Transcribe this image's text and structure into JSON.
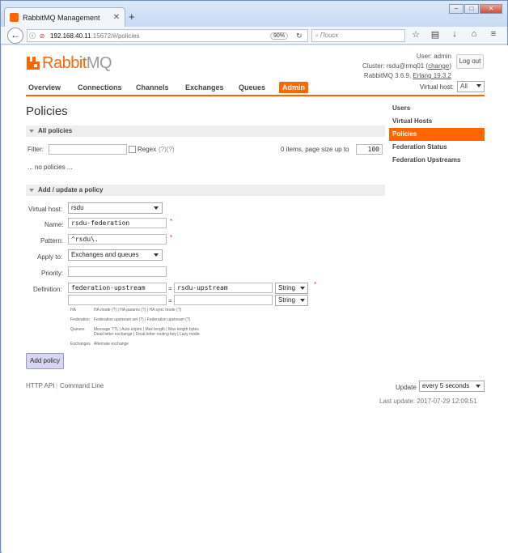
{
  "browser": {
    "tab_title": "RabbitMQ Management",
    "url_host": "192.168.40.11",
    "url_path": ":15672/#/policies",
    "zoom": "90%",
    "search_placeholder": "Поиск"
  },
  "header": {
    "logo_rabbit": "Rabbit",
    "logo_mq": "MQ",
    "user_line": "User: admin",
    "cluster_prefix": "Cluster: rsdu@rmq01 (",
    "cluster_change": "change",
    "cluster_suffix": ")",
    "version_prefix": "RabbitMQ 3.6.9, ",
    "erlang": "Erlang 19.3.2",
    "logout": "Log out"
  },
  "nav": {
    "items": [
      "Overview",
      "Connections",
      "Channels",
      "Exchanges",
      "Queues",
      "Admin"
    ],
    "vhost_label": "Virtual host:",
    "vhost_value": "All"
  },
  "page_title": "Policies",
  "sidebar": {
    "items": [
      "Users",
      "Virtual Hosts",
      "Policies",
      "Federation Status",
      "Federation Upstreams"
    ]
  },
  "all_policies": {
    "header": "All policies",
    "filter_label": "Filter:",
    "regex_label": "Regex",
    "regex_help": "(?)(?)",
    "items_text": "0 items, page size up to",
    "page_size": "100",
    "empty_text": "... no policies ..."
  },
  "add_policy": {
    "header": "Add / update a policy",
    "vhost_label": "Virtual host:",
    "vhost_value": "rsdu",
    "name_label": "Name:",
    "name_value": "rsdu-federation",
    "pattern_label": "Pattern:",
    "pattern_value": "^rsdu\\.",
    "apply_label": "Apply to:",
    "apply_value": "Exchanges and queues",
    "priority_label": "Priority:",
    "definition_label": "Definition:",
    "def_key_1": "federation-upstream",
    "def_eq": "=",
    "def_value_1": "rsdu-upstream",
    "def_type_1": "String",
    "def_type_2": "String",
    "help": {
      "ha_label": "HA",
      "ha_text": "HA mode (?) | HA params (?) | HA sync mode (?)",
      "fed_label": "Federation",
      "fed_text": "Federation upstream set (?) | Federation upstream (?)",
      "queues_label": "Queues",
      "queues_text_1": "Message TTL | Auto expire | Max length | Max length bytes",
      "queues_text_2": "Dead letter exchange | Dead letter routing key | Lazy mode",
      "exch_label": "Exchanges",
      "exch_text": "Alternate exchange"
    },
    "submit": "Add policy"
  },
  "footer": {
    "http_api": "HTTP API",
    "separator": "|",
    "command_line": "Command Line",
    "update_label": "Update",
    "update_value": "every 5 seconds",
    "last_update": "Last update: 2017-07-29 12:09:51"
  },
  "colors": {
    "accent": "#ff6600",
    "button": "#d6d6f4"
  }
}
